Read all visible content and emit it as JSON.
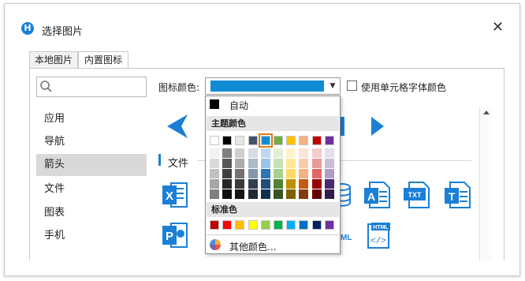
{
  "dialog": {
    "title": "选择图片",
    "title_icon": "app-logo-icon"
  },
  "tabs": [
    {
      "label": "本地图片",
      "active": false
    },
    {
      "label": "内置图标",
      "active": true
    }
  ],
  "search": {
    "value": "",
    "placeholder": ""
  },
  "sidebar": {
    "items": [
      {
        "label": "应用",
        "selected": false
      },
      {
        "label": "导航",
        "selected": false
      },
      {
        "label": "箭头",
        "selected": true
      },
      {
        "label": "文件",
        "selected": false
      },
      {
        "label": "图表",
        "selected": false
      },
      {
        "label": "手机",
        "selected": false
      }
    ]
  },
  "icon_color": {
    "label": "图标颜色:",
    "value_color": "#0f8bd6"
  },
  "use_cell_font_color": {
    "label": "使用单元格字体颜色",
    "checked": false
  },
  "section": {
    "label": "文件"
  },
  "file_icons": [
    {
      "name": "excel-file-icon",
      "color": "#1a7fd6"
    },
    {
      "name": "word-file-icon",
      "color": "#1a7fd6"
    },
    {
      "name": "txt-file-icon",
      "color": "#1a7fd6",
      "text": "TXT"
    },
    {
      "name": "text-file-icon",
      "color": "#1a7fd6"
    },
    {
      "name": "powerpoint-file-icon",
      "color": "#1a7fd6"
    },
    {
      "name": "html-file-icon",
      "color": "#1a7fd6",
      "text": "HTML"
    }
  ],
  "color_popup": {
    "auto_label": "自动",
    "theme_label": "主题颜色",
    "standard_label": "标准色",
    "more_label": "其他颜色...",
    "theme_top": [
      "#ffffff",
      "#000000",
      "#e7e6e6",
      "#44546a",
      "#0f8bd6",
      "#70ad47",
      "#ffc000",
      "#f4b183",
      "#c00000",
      "#7030a0"
    ],
    "theme_shades": [
      [
        "#f2f2f2",
        "#7f7f7f",
        "#d0cece",
        "#d6dce4",
        "#bdd7ee",
        "#e2efda",
        "#fff2cc",
        "#fbe5d6",
        "#f4cccc",
        "#e4dfec"
      ],
      [
        "#d9d9d9",
        "#595959",
        "#aeabab",
        "#adb9ca",
        "#9dc3e6",
        "#c5e0b4",
        "#ffe699",
        "#f8cbad",
        "#ea9999",
        "#c9bfd9"
      ],
      [
        "#bfbfbf",
        "#404040",
        "#757171",
        "#8497b0",
        "#2e75b6",
        "#a9d18e",
        "#ffd966",
        "#f4b183",
        "#e06666",
        "#ae9fc6"
      ],
      [
        "#a6a6a6",
        "#262626",
        "#3a3838",
        "#333f4f",
        "#1f4e79",
        "#548235",
        "#bf9000",
        "#c55a11",
        "#990000",
        "#4b2a6f"
      ],
      [
        "#808080",
        "#0d0d0d",
        "#171616",
        "#222a35",
        "#10304f",
        "#375623",
        "#7f6000",
        "#843c0c",
        "#660000",
        "#321c4a"
      ]
    ],
    "standard": [
      "#c00000",
      "#ff0000",
      "#ffc000",
      "#ffff00",
      "#92d050",
      "#00b050",
      "#00b0f0",
      "#0070c0",
      "#002060",
      "#7030a0"
    ]
  }
}
